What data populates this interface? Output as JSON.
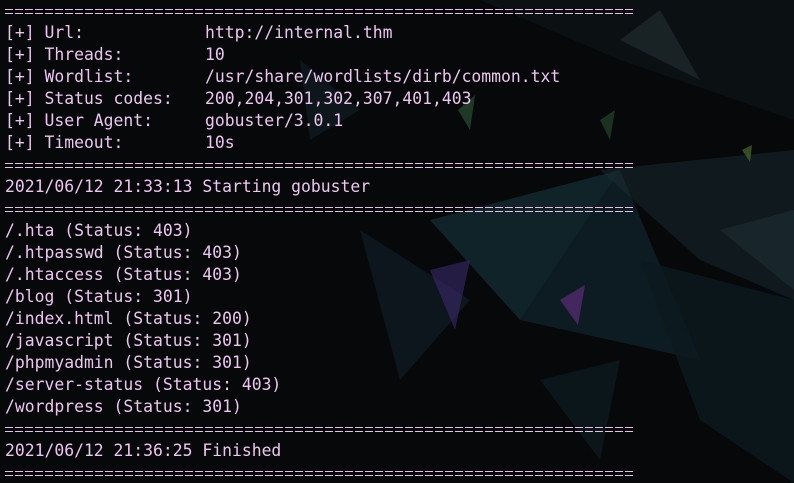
{
  "config": [
    {
      "label": "[+] Url:",
      "value": "http://internal.thm"
    },
    {
      "label": "[+] Threads:",
      "value": "10"
    },
    {
      "label": "[+] Wordlist:",
      "value": "/usr/share/wordlists/dirb/common.txt"
    },
    {
      "label": "[+] Status codes:",
      "value": "200,204,301,302,307,401,403"
    },
    {
      "label": "[+] User Agent:",
      "value": "gobuster/3.0.1"
    },
    {
      "label": "[+] Timeout:",
      "value": "10s"
    }
  ],
  "start_message": "2021/06/12 21:33:13 Starting gobuster",
  "results": [
    "/.hta (Status: 403)",
    "/.htpasswd (Status: 403)",
    "/.htaccess (Status: 403)",
    "/blog (Status: 301)",
    "/index.html (Status: 200)",
    "/javascript (Status: 301)",
    "/phpmyadmin (Status: 301)",
    "/server-status (Status: 403)",
    "/wordpress (Status: 301)"
  ],
  "finish_message": "2021/06/12 21:36:25 Finished",
  "colors": {
    "background": "#06080a",
    "text": "#ecc6ee"
  }
}
